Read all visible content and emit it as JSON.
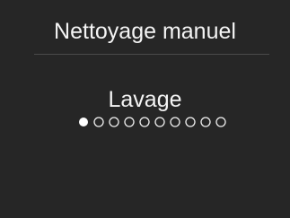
{
  "screen": {
    "title": "Nettoyage manuel",
    "status": "Lavage",
    "background_color": "#262626",
    "text_color": "#f4f4f4"
  },
  "progress": {
    "total_steps": 10,
    "current_step": 1,
    "active_color": "#ffffff",
    "inactive_color": "#f0f0f0"
  }
}
